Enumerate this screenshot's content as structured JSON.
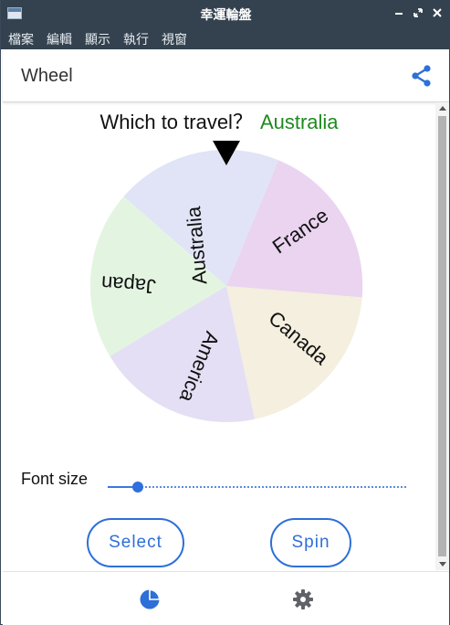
{
  "window": {
    "title": "幸運輪盤",
    "controls": [
      "minimize-icon",
      "restore-icon",
      "close-icon"
    ]
  },
  "menu": {
    "items": [
      "檔案",
      "編輯",
      "顯示",
      "執行",
      "視窗"
    ]
  },
  "appbar": {
    "title": "Wheel",
    "share_icon": "share-icon",
    "accent": "#2e6fd8"
  },
  "question": {
    "text": "Which to travel？",
    "answer": "Australia",
    "answer_color": "#1f8a1f"
  },
  "wheel": {
    "pointer_icon": "triangle-down-icon",
    "segments": [
      {
        "label": "Australia",
        "color": "#e1e4f6"
      },
      {
        "label": "France",
        "color": "#ead4f0"
      },
      {
        "label": "Canada",
        "color": "#f4efdf"
      },
      {
        "label": "America",
        "color": "#e4dff4"
      },
      {
        "label": "Japan",
        "color": "#e3f5e1"
      }
    ]
  },
  "font_size": {
    "label": "Font size",
    "value_fraction": 0.1
  },
  "buttons": {
    "select": "Select",
    "spin": "Spin"
  },
  "bottom_nav": {
    "items": [
      {
        "icon": "pie-chart-icon",
        "active": true
      },
      {
        "icon": "gear-icon",
        "active": false
      }
    ]
  }
}
